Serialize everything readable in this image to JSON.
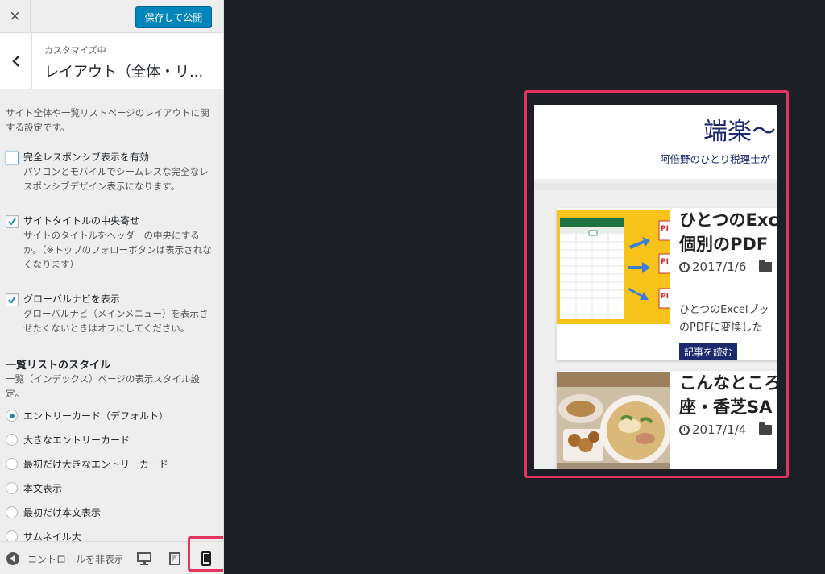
{
  "topbar": {
    "close_icon": "×",
    "publish_label": "保存して公開"
  },
  "section": {
    "customizing_label": "カスタマイズ中",
    "title": "レイアウト（全体・リ..."
  },
  "controls": {
    "section_description": "サイト全体や一覧リストページのレイアウトに関する設定です。",
    "checkboxes": [
      {
        "label": "完全レスポンシブ表示を有効",
        "description": "パソコンとモバイルでシームレスな完全なレスポンシブデザイン表示になります。",
        "checked": false
      },
      {
        "label": "サイトタイトルの中央寄せ",
        "description": "サイトのタイトルをヘッダーの中央にするか。（※トップのフォローボタンは表示されなくなります）",
        "checked": true
      },
      {
        "label": "グローバルナビを表示",
        "description": "グローバルナビ（メインメニュー）を表示させたくないときはオフにしてください。",
        "checked": true
      }
    ],
    "list_style": {
      "title": "一覧リストのスタイル",
      "description": "一覧（インデックス）ページの表示スタイル設定。",
      "options": [
        {
          "label": "エントリーカード（デフォルト）",
          "checked": true
        },
        {
          "label": "大きなエントリーカード",
          "checked": false
        },
        {
          "label": "最初だけ大きなエントリーカード",
          "checked": false
        },
        {
          "label": "本文表示",
          "checked": false
        },
        {
          "label": "最初だけ本文表示",
          "checked": false
        },
        {
          "label": "サムネイル大",
          "checked": false
        }
      ]
    }
  },
  "footer": {
    "collapse_label": "コントロールを非表示",
    "devices": [
      "desktop-icon",
      "tablet-icon",
      "mobile-icon"
    ],
    "active_device": "mobile"
  },
  "preview": {
    "site_title": "端楽〜",
    "site_description": "阿倍野のひとり税理士が",
    "posts": [
      {
        "title_line1": "ひとつのExce",
        "title_line2": "個別のPDF",
        "date": "2017/1/6",
        "excerpt_line1": "ひとつのExcelブッ",
        "excerpt_line2": "のPDFに変換した",
        "read_more": "記事を読む"
      },
      {
        "title_line1": "こんなところ",
        "title_line2": "座・香芝SA",
        "date": "2017/1/4"
      }
    ]
  },
  "colors": {
    "accent_highlight": "#e5335f",
    "publish_button": "#0085ba",
    "checkbox_check": "#1e8cbe",
    "site_navy": "#1a2a6c",
    "preview_background": "#1c1f26"
  }
}
